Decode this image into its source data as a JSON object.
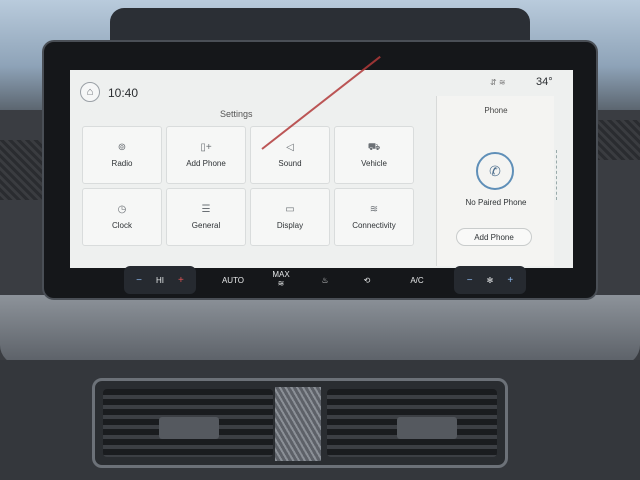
{
  "status": {
    "home_icon": "home-icon",
    "time": "10:40",
    "status_icons": "⇵ ≋",
    "temperature": "34°"
  },
  "settings": {
    "title": "Settings",
    "tiles": [
      {
        "label": "Radio",
        "icon": "radio-icon",
        "glyph": "⊚"
      },
      {
        "label": "Add Phone",
        "icon": "add-phone-icon",
        "glyph": "▯+"
      },
      {
        "label": "Sound",
        "icon": "sound-icon",
        "glyph": "◁"
      },
      {
        "label": "Vehicle",
        "icon": "vehicle-icon",
        "glyph": "⛟"
      },
      {
        "label": "Clock",
        "icon": "clock-icon",
        "glyph": "◷"
      },
      {
        "label": "General",
        "icon": "general-icon",
        "glyph": "☰"
      },
      {
        "label": "Display",
        "icon": "display-icon",
        "glyph": "▭"
      },
      {
        "label": "Connectivity",
        "icon": "wifi-icon",
        "glyph": "≋"
      }
    ]
  },
  "phone": {
    "title": "Phone",
    "icon": "phone-icon",
    "glyph": "✆",
    "no_paired": "No Paired Phone",
    "add_button": "Add Phone"
  },
  "climate": {
    "minus": "−",
    "fan_level": "HI",
    "plus": "+",
    "auto": "AUTO",
    "max": "MAX",
    "ac": "A/C",
    "fan_icon": "fan-icon",
    "defrost_icon": "defrost-icon",
    "recirc_icon": "recirculate-icon",
    "seat_icon": "heated-seat-icon"
  },
  "colors": {
    "screen_bg": "#eef0ef",
    "accent_blue": "#5f8fb8",
    "temp_red": "#e05353"
  }
}
